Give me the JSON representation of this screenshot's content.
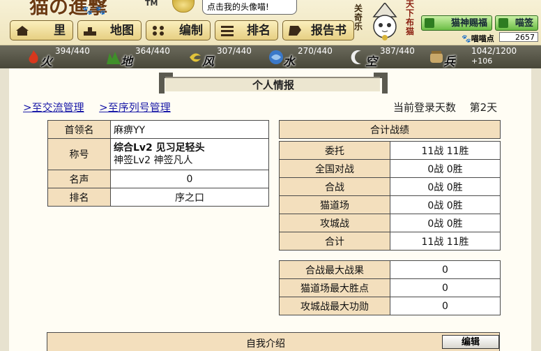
{
  "header": {
    "logo_text": "猫の進撃",
    "logo_tm": "TM",
    "bubble_text": "点击我的头像喵!",
    "nav": [
      {
        "label": "里",
        "icon": "house-icon"
      },
      {
        "label": "地图",
        "icon": "map-icon"
      },
      {
        "label": "编制",
        "icon": "formation-icon"
      },
      {
        "label": "排名",
        "icon": "ranking-icon"
      },
      {
        "label": "报告书",
        "icon": "report-icon"
      }
    ],
    "mascot_left_text": "关奇乐",
    "mascot_right_text": "天下布猫",
    "gift_button": "猫神赐福",
    "draw_button": "喵签",
    "points_label": "喵喵点",
    "points_value": "2657"
  },
  "resources": [
    {
      "name": "火",
      "value": "394/440",
      "icon": "fire-icon",
      "color": "#d8371d"
    },
    {
      "name": "地",
      "value": "364/440",
      "icon": "earth-icon",
      "color": "#3f8f2a"
    },
    {
      "name": "风",
      "value": "307/440",
      "icon": "wind-icon",
      "color": "#e1c33a"
    },
    {
      "name": "水",
      "value": "270/440",
      "icon": "water-icon",
      "color": "#3a78c9"
    },
    {
      "name": "空",
      "value": "387/440",
      "icon": "sky-icon",
      "color": "#dddddd"
    },
    {
      "name": "兵粮",
      "value": "1042/1200",
      "sub": "+106",
      "icon": "rice-icon",
      "color": "#c9a86a"
    }
  ],
  "page": {
    "title": "个人情报",
    "link_exchange": ">至交流管理",
    "link_serial": ">至序列号管理",
    "login_label": "当前登录天数",
    "login_value": "第2天"
  },
  "profile": {
    "leader_label": "首领名",
    "leader_value": "麻痹YY",
    "title_label": "称号",
    "title_line1": "综合Lv2 见习足轻头",
    "title_line2": "神签Lv2 神签凡人",
    "fame_label": "名声",
    "fame_value": "0",
    "rank_label": "排名",
    "rank_value": "序之口"
  },
  "record": {
    "header": "合计战绩",
    "rows": [
      {
        "label": "委托",
        "value": "11战  11胜"
      },
      {
        "label": "全国对战",
        "value": "0战  0胜"
      },
      {
        "label": "合战",
        "value": "0战  0胜"
      },
      {
        "label": "猫道场",
        "value": "0战  0胜"
      },
      {
        "label": "攻城战",
        "value": "0战  0胜"
      },
      {
        "label": "合计",
        "value": "11战  11胜"
      }
    ],
    "extra": [
      {
        "label": "合战最大战果",
        "value": "0"
      },
      {
        "label": "猫道场最大胜点",
        "value": "0"
      },
      {
        "label": "攻城战最大功勋",
        "value": "0"
      }
    ]
  },
  "intro": {
    "title": "自我介绍",
    "edit_button": "编辑"
  }
}
